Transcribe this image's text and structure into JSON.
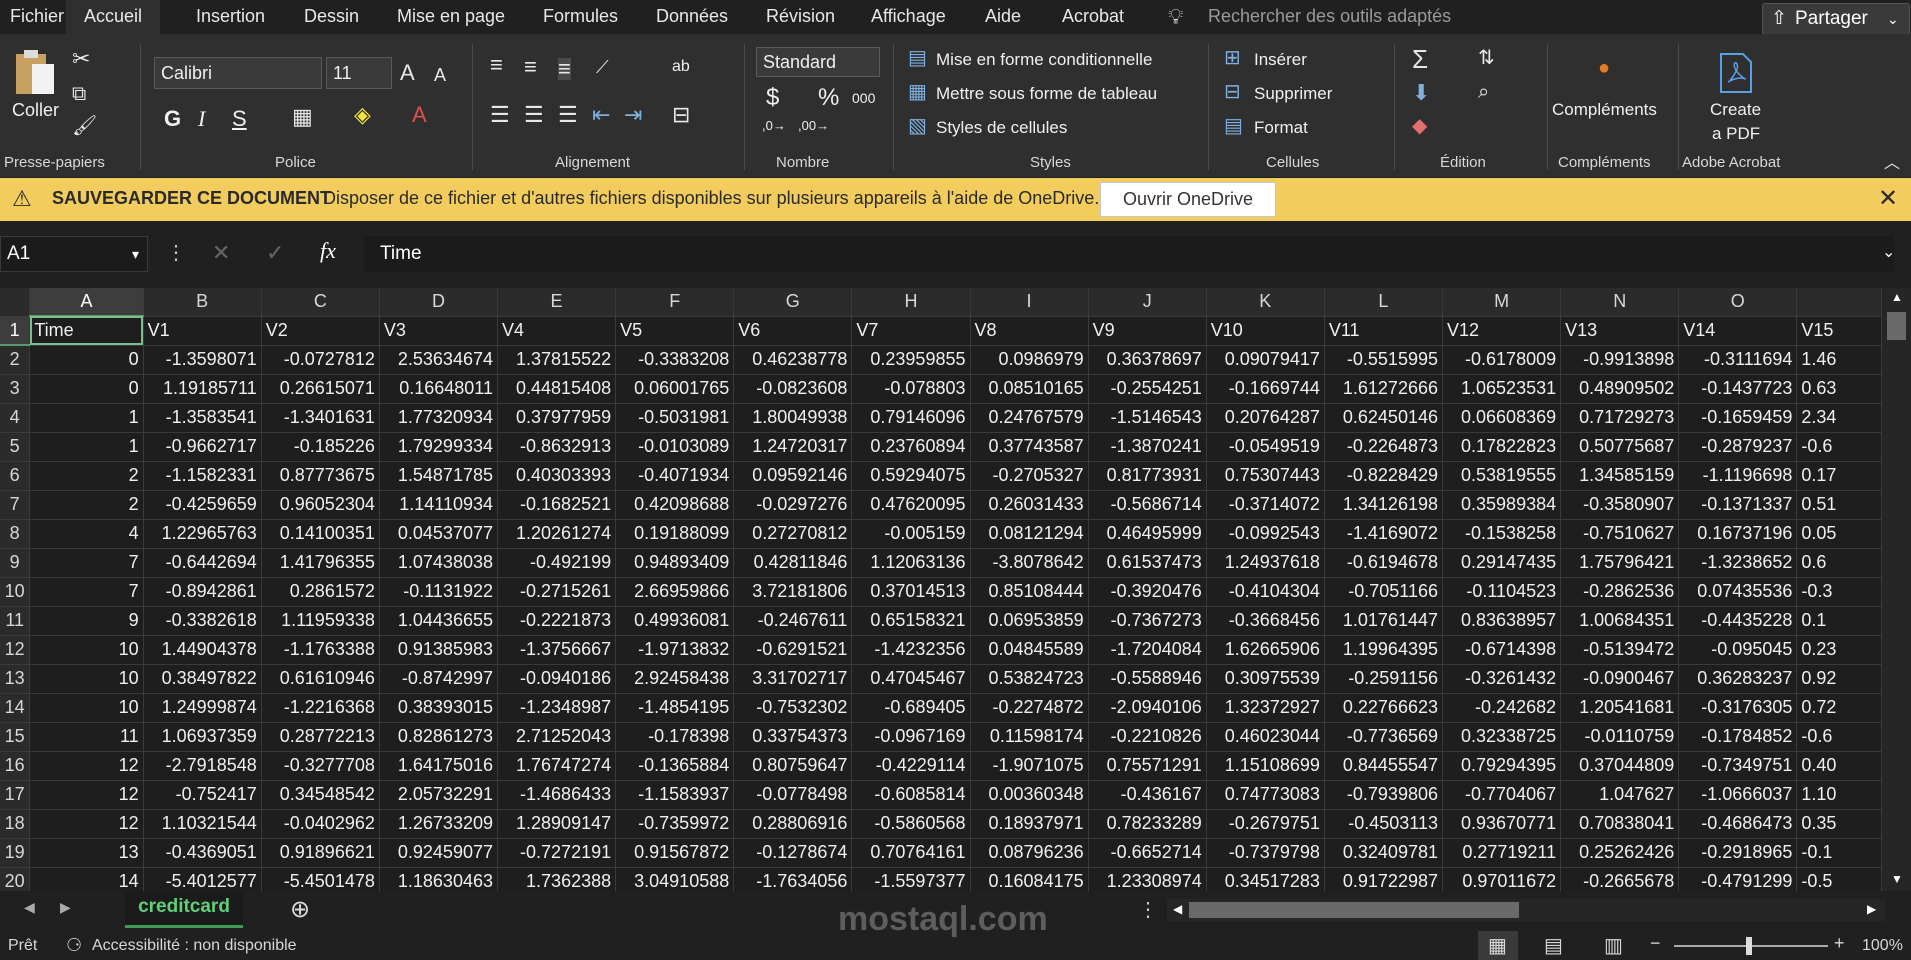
{
  "menu": {
    "tabs": [
      "Fichier",
      "Accueil",
      "Insertion",
      "Dessin",
      "Mise en page",
      "Formules",
      "Données",
      "Révision",
      "Affichage",
      "Aide",
      "Acrobat"
    ],
    "active": "Accueil",
    "search_placeholder": "Rechercher des outils adaptés",
    "share_label": "Partager"
  },
  "ribbon": {
    "paste_label": "Coller",
    "font_name": "Calibri",
    "font_size": "11",
    "bold": "G",
    "italic": "I",
    "underline": "S",
    "number_format": "Standard",
    "currency": "$",
    "percent": "%",
    "thousands": "000",
    "cond_format": "Mise en forme conditionnelle",
    "format_table": "Mettre sous forme de tableau",
    "cell_styles": "Styles de cellules",
    "insert": "Insérer",
    "delete": "Supprimer",
    "format": "Format",
    "addins": "Compléments",
    "create_pdf_1": "Create",
    "create_pdf_2": "a PDF",
    "groups": [
      "Presse-papiers",
      "Police",
      "Alignement",
      "Nombre",
      "Styles",
      "Cellules",
      "Édition",
      "Compléments",
      "Adobe Acrobat"
    ]
  },
  "message": {
    "title": "SAUVEGARDER CE DOCUMENT",
    "text": "Disposer de ce fichier et d'autres fichiers disponibles sur plusieurs appareils à l'aide de OneDrive.",
    "button": "Ouvrir OneDrive"
  },
  "formula": {
    "cell_ref": "A1",
    "content": "Time"
  },
  "sheet": {
    "columns": [
      "A",
      "B",
      "C",
      "D",
      "E",
      "F",
      "G",
      "H",
      "I",
      "J",
      "K",
      "L",
      "M",
      "N",
      "O",
      ""
    ],
    "header_row": [
      "Time",
      "V1",
      "V2",
      "V3",
      "V4",
      "V5",
      "V6",
      "V7",
      "V8",
      "V9",
      "V10",
      "V11",
      "V12",
      "V13",
      "V14",
      "V15"
    ],
    "rows": [
      [
        "0",
        "-1.3598071",
        "-0.0727812",
        "2.53634674",
        "1.37815522",
        "-0.3383208",
        "0.46238778",
        "0.23959855",
        "0.0986979",
        "0.36378697",
        "0.09079417",
        "-0.5515995",
        "-0.6178009",
        "-0.9913898",
        "-0.3111694",
        "1.46"
      ],
      [
        "0",
        "1.19185711",
        "0.26615071",
        "0.16648011",
        "0.44815408",
        "0.06001765",
        "-0.0823608",
        "-0.078803",
        "0.08510165",
        "-0.2554251",
        "-0.1669744",
        "1.61272666",
        "1.06523531",
        "0.48909502",
        "-0.1437723",
        "0.63"
      ],
      [
        "1",
        "-1.3583541",
        "-1.3401631",
        "1.77320934",
        "0.37977959",
        "-0.5031981",
        "1.80049938",
        "0.79146096",
        "0.24767579",
        "-1.5146543",
        "0.20764287",
        "0.62450146",
        "0.06608369",
        "0.71729273",
        "-0.1659459",
        "2.34"
      ],
      [
        "1",
        "-0.9662717",
        "-0.185226",
        "1.79299334",
        "-0.8632913",
        "-0.0103089",
        "1.24720317",
        "0.23760894",
        "0.37743587",
        "-1.3870241",
        "-0.0549519",
        "-0.2264873",
        "0.17822823",
        "0.50775687",
        "-0.2879237",
        "-0.6"
      ],
      [
        "2",
        "-1.1582331",
        "0.87773675",
        "1.54871785",
        "0.40303393",
        "-0.4071934",
        "0.09592146",
        "0.59294075",
        "-0.2705327",
        "0.81773931",
        "0.75307443",
        "-0.8228429",
        "0.53819555",
        "1.34585159",
        "-1.1196698",
        "0.17"
      ],
      [
        "2",
        "-0.4259659",
        "0.96052304",
        "1.14110934",
        "-0.1682521",
        "0.42098688",
        "-0.0297276",
        "0.47620095",
        "0.26031433",
        "-0.5686714",
        "-0.3714072",
        "1.34126198",
        "0.35989384",
        "-0.3580907",
        "-0.1371337",
        "0.51"
      ],
      [
        "4",
        "1.22965763",
        "0.14100351",
        "0.04537077",
        "1.20261274",
        "0.19188099",
        "0.27270812",
        "-0.005159",
        "0.08121294",
        "0.46495999",
        "-0.0992543",
        "-1.4169072",
        "-0.1538258",
        "-0.7510627",
        "0.16737196",
        "0.05"
      ],
      [
        "7",
        "-0.6442694",
        "1.41796355",
        "1.07438038",
        "-0.492199",
        "0.94893409",
        "0.42811846",
        "1.12063136",
        "-3.8078642",
        "0.61537473",
        "1.24937618",
        "-0.6194678",
        "0.29147435",
        "1.75796421",
        "-1.3238652",
        "0.6"
      ],
      [
        "7",
        "-0.8942861",
        "0.2861572",
        "-0.1131922",
        "-0.2715261",
        "2.66959866",
        "3.72181806",
        "0.37014513",
        "0.85108444",
        "-0.3920476",
        "-0.4104304",
        "-0.7051166",
        "-0.1104523",
        "-0.2862536",
        "0.07435536",
        "-0.3"
      ],
      [
        "9",
        "-0.3382618",
        "1.11959338",
        "1.04436655",
        "-0.2221873",
        "0.49936081",
        "-0.2467611",
        "0.65158321",
        "0.06953859",
        "-0.7367273",
        "-0.3668456",
        "1.01761447",
        "0.83638957",
        "1.00684351",
        "-0.4435228",
        "0.1"
      ],
      [
        "10",
        "1.44904378",
        "-1.1763388",
        "0.91385983",
        "-1.3756667",
        "-1.9713832",
        "-0.6291521",
        "-1.4232356",
        "0.04845589",
        "-1.7204084",
        "1.62665906",
        "1.19964395",
        "-0.6714398",
        "-0.5139472",
        "-0.095045",
        "0.23"
      ],
      [
        "10",
        "0.38497822",
        "0.61610946",
        "-0.8742997",
        "-0.0940186",
        "2.92458438",
        "3.31702717",
        "0.47045467",
        "0.53824723",
        "-0.5588946",
        "0.30975539",
        "-0.2591156",
        "-0.3261432",
        "-0.0900467",
        "0.36283237",
        "0.92"
      ],
      [
        "10",
        "1.24999874",
        "-1.2216368",
        "0.38393015",
        "-1.2348987",
        "-1.4854195",
        "-0.7532302",
        "-0.689405",
        "-0.2274872",
        "-2.0940106",
        "1.32372927",
        "0.22766623",
        "-0.242682",
        "1.20541681",
        "-0.3176305",
        "0.72"
      ],
      [
        "11",
        "1.06937359",
        "0.28772213",
        "0.82861273",
        "2.71252043",
        "-0.178398",
        "0.33754373",
        "-0.0967169",
        "0.11598174",
        "-0.2210826",
        "0.46023044",
        "-0.7736569",
        "0.32338725",
        "-0.0110759",
        "-0.1784852",
        "-0.6"
      ],
      [
        "12",
        "-2.7918548",
        "-0.3277708",
        "1.64175016",
        "1.76747274",
        "-0.1365884",
        "0.80759647",
        "-0.4229114",
        "-1.9071075",
        "0.75571291",
        "1.15108699",
        "0.84455547",
        "0.79294395",
        "0.37044809",
        "-0.7349751",
        "0.40"
      ],
      [
        "12",
        "-0.752417",
        "0.34548542",
        "2.05732291",
        "-1.4686433",
        "-1.1583937",
        "-0.0778498",
        "-0.6085814",
        "0.00360348",
        "-0.436167",
        "0.74773083",
        "-0.7939806",
        "-0.7704067",
        "1.047627",
        "-1.0666037",
        "1.10"
      ],
      [
        "12",
        "1.10321544",
        "-0.0402962",
        "1.26733209",
        "1.28909147",
        "-0.7359972",
        "0.28806916",
        "-0.5860568",
        "0.18937971",
        "0.78233289",
        "-0.2679751",
        "-0.4503113",
        "0.93670771",
        "0.70838041",
        "-0.4686473",
        "0.35"
      ],
      [
        "13",
        "-0.4369051",
        "0.91896621",
        "0.92459077",
        "-0.7272191",
        "0.91567872",
        "-0.1278674",
        "0.70764161",
        "0.08796236",
        "-0.6652714",
        "-0.7379798",
        "0.32409781",
        "0.27719211",
        "0.25262426",
        "-0.2918965",
        "-0.1"
      ],
      [
        "14",
        "-5.4012577",
        "-5.4501478",
        "1.18630463",
        "1.7362388",
        "3.04910588",
        "-1.7634056",
        "-1.5597377",
        "0.16084175",
        "1.23308974",
        "0.34517283",
        "0.91722987",
        "0.97011672",
        "-0.2665678",
        "-0.4791299",
        "-0.5"
      ]
    ],
    "sheet_tab": "creditcard"
  },
  "status": {
    "ready": "Prêt",
    "accessibility": "Accessibilité : non disponible",
    "zoom": "100%"
  },
  "watermark": "mostaql.com"
}
